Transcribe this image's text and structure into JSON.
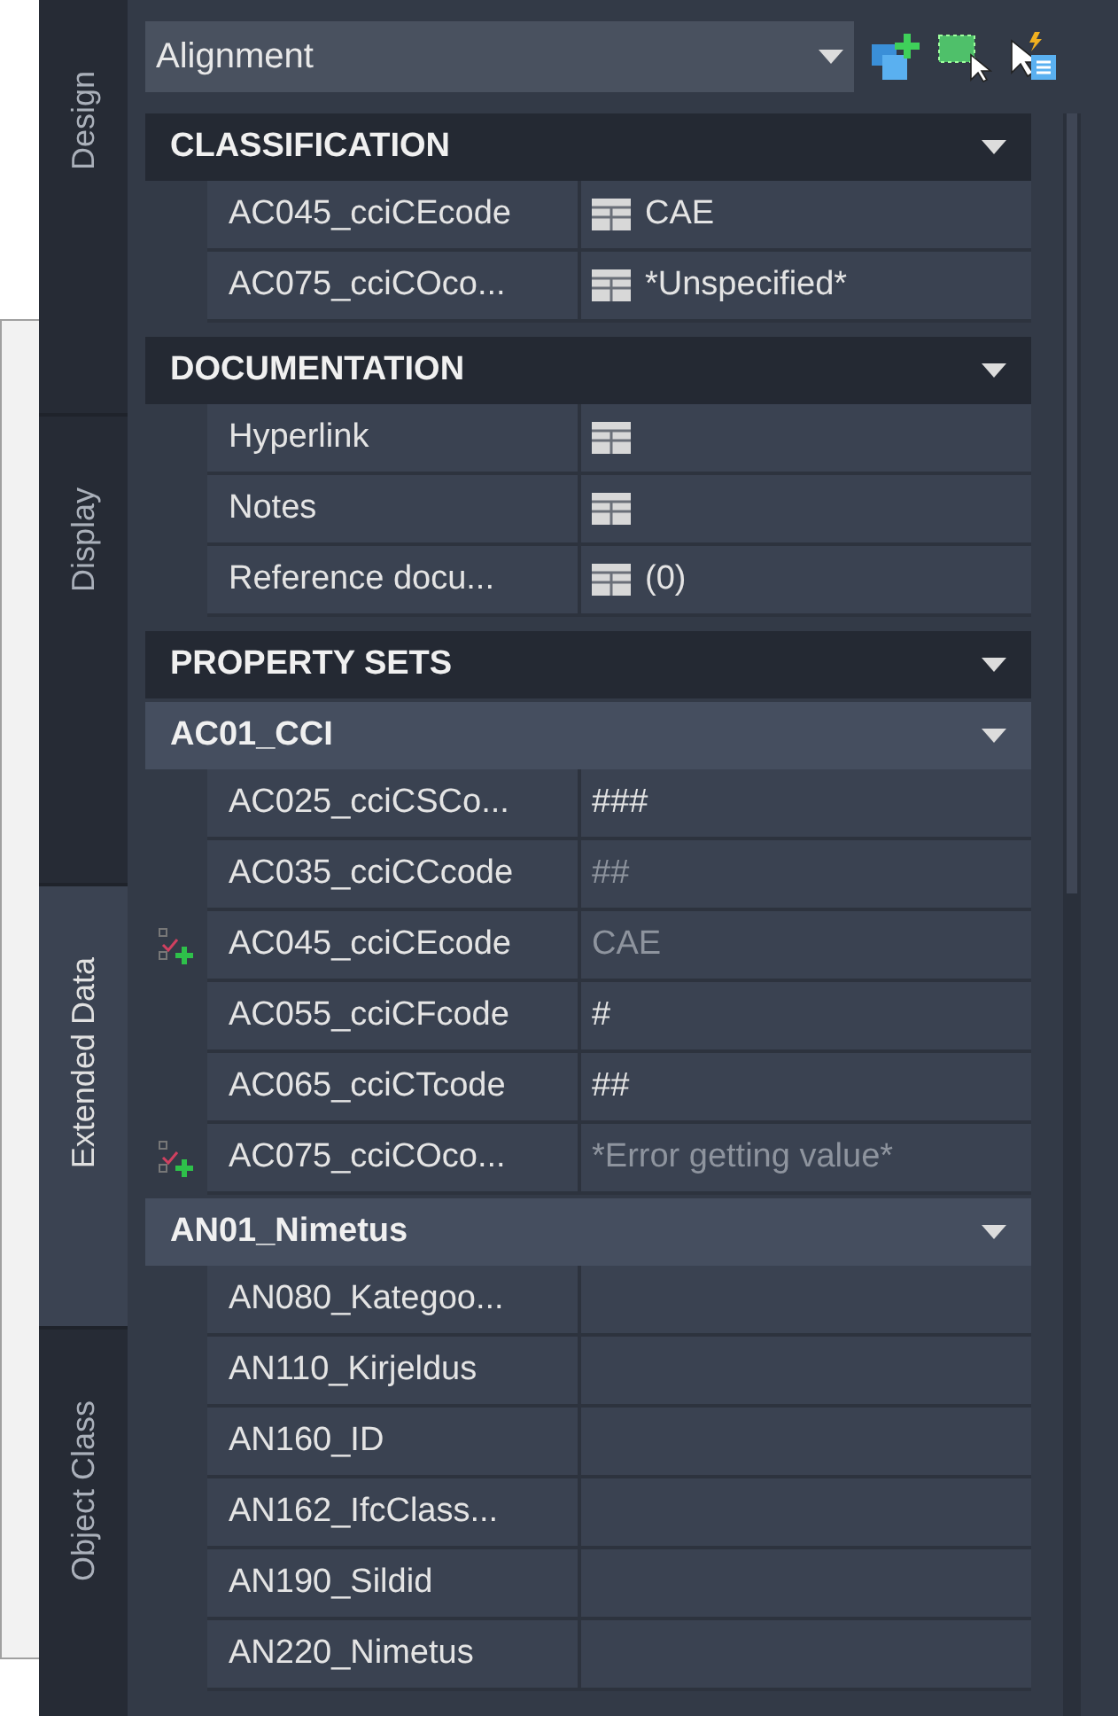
{
  "object_type": {
    "value": "Alignment"
  },
  "tabs": [
    {
      "label": "Design",
      "selected": false
    },
    {
      "label": "Display",
      "selected": false
    },
    {
      "label": "Extended Data",
      "selected": true
    },
    {
      "label": "Object Class",
      "selected": false
    }
  ],
  "sections": [
    {
      "kind": "category",
      "title": "CLASSIFICATION",
      "expanded": true,
      "rows": [
        {
          "label": "AC045_cciCEcode",
          "value": "CAE",
          "value_icon": true,
          "dimmed": false,
          "override": false
        },
        {
          "label": "AC075_cciCOco...",
          "value": "*Unspecified*",
          "value_icon": true,
          "dimmed": false,
          "override": false
        }
      ]
    },
    {
      "kind": "category",
      "title": "DOCUMENTATION",
      "expanded": true,
      "rows": [
        {
          "label": "Hyperlink",
          "value_icon": true,
          "override": false
        },
        {
          "label": "Notes",
          "value_icon": true,
          "override": false
        },
        {
          "label": "Reference docu...",
          "value": "(0)",
          "value_icon": true,
          "dimmed": false,
          "override": false
        }
      ]
    },
    {
      "kind": "category",
      "title": "PROPERTY SETS",
      "expanded": true
    },
    {
      "kind": "set",
      "title": "AC01_CCI",
      "expanded": true,
      "rows": [
        {
          "label": "AC025_cciCSCo...",
          "value": "###",
          "value_icon": false,
          "dimmed": false,
          "override": false
        },
        {
          "label": "AC035_cciCCcode",
          "value": "##",
          "value_icon": false,
          "dimmed": true,
          "override": false
        },
        {
          "label": "AC045_cciCEcode",
          "value": "CAE",
          "value_icon": false,
          "dimmed": true,
          "override": true
        },
        {
          "label": "AC055_cciCFcode",
          "value": "#",
          "value_icon": false,
          "dimmed": false,
          "override": false
        },
        {
          "label": "AC065_cciCTcode",
          "value": "##",
          "value_icon": false,
          "dimmed": false,
          "override": false
        },
        {
          "label": "AC075_cciCOco...",
          "value": "*Error getting value*",
          "value_icon": false,
          "dimmed": true,
          "override": true
        }
      ]
    },
    {
      "kind": "set",
      "title": "AN01_Nimetus",
      "expanded": true,
      "rows": [
        {
          "label": "AN080_Kategoo...",
          "value_icon": false,
          "override": false
        },
        {
          "label": "AN110_Kirjeldus",
          "value_icon": false,
          "override": false
        },
        {
          "label": "AN160_ID",
          "value_icon": false,
          "override": false
        },
        {
          "label": "AN162_IfcClass...",
          "value_icon": false,
          "override": false
        },
        {
          "label": "AN190_Sildid",
          "value_icon": false,
          "override": false
        },
        {
          "label": "AN220_Nimetus",
          "value_icon": false,
          "override": false
        }
      ]
    }
  ]
}
